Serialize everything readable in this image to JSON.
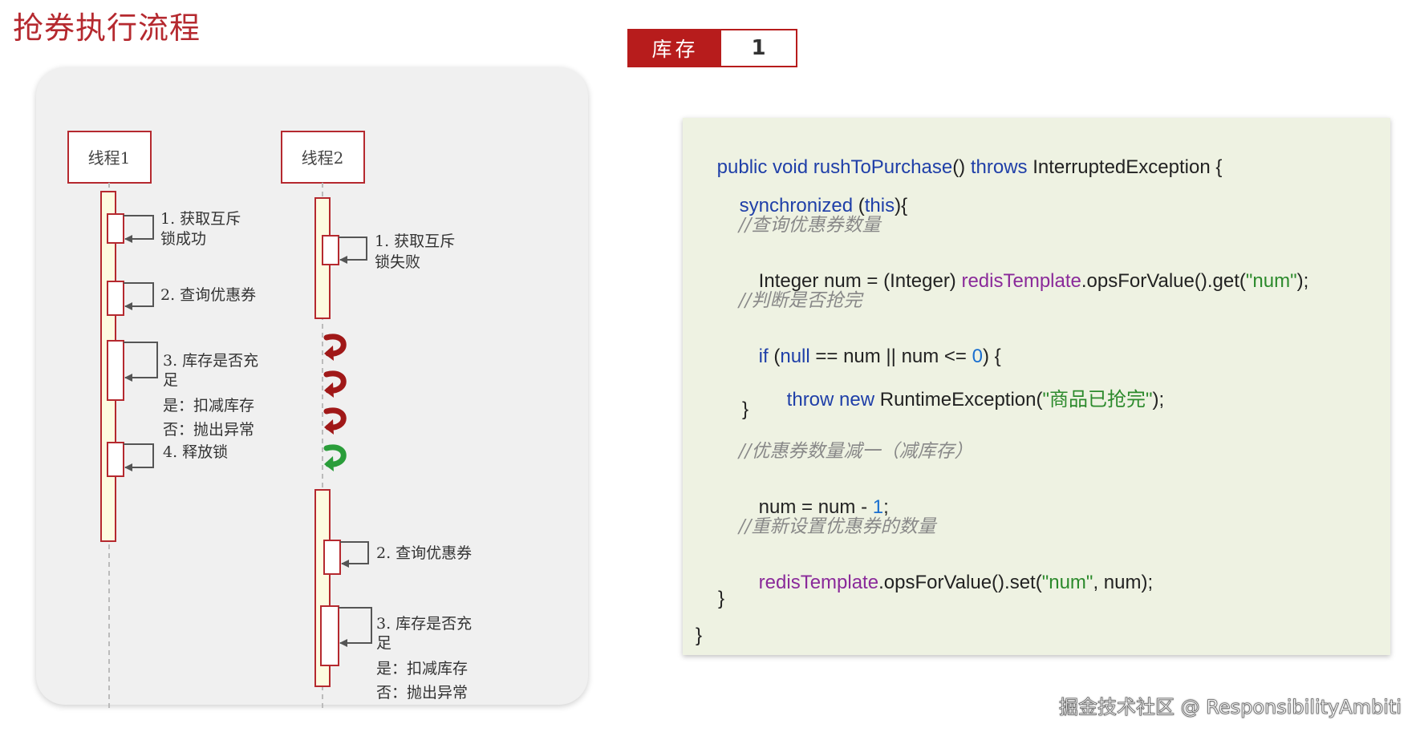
{
  "title": "抢券执行流程",
  "stock": {
    "label": "库存",
    "value": "1"
  },
  "colors": {
    "accent": "#b71c1c",
    "fail_arrow": "#a01818",
    "success_arrow": "#2a9d3a"
  },
  "threads": {
    "t1": {
      "label": "线程1",
      "steps": [
        "1. 获取互斥",
        "锁成功",
        "2. 查询优惠券",
        "3. 库存是否充",
        "足",
        "是：扣减库存",
        "否：抛出异常",
        "4. 释放锁"
      ]
    },
    "t2": {
      "label": "线程2",
      "steps": [
        "1. 获取互斥",
        "锁失败",
        "2. 查询优惠券",
        "3. 库存是否充",
        "足",
        "是：扣减库存",
        "否：抛出异常"
      ]
    },
    "retry_icons": [
      "fail-retry-arrow-icon",
      "fail-retry-arrow-icon",
      "fail-retry-arrow-icon",
      "success-arrow-icon"
    ]
  },
  "code": {
    "l1": {
      "a": "public void ",
      "b": "rushToPurchase",
      "c": "() ",
      "d": "throws",
      "e": " InterruptedException {"
    },
    "l2": {
      "a": "synchronized",
      "b": " (",
      "c": "this",
      "d": "){"
    },
    "l3": "//查询优惠券数量",
    "l4": {
      "a": "Integer num = (Integer) ",
      "b": "redisTemplate",
      "c": ".opsForValue().get(",
      "d": "\"num\"",
      "e": ");"
    },
    "l5": "//判断是否抢完",
    "l6": {
      "a": "if",
      "b": " (",
      "c": "null",
      "d": " == num || num <= ",
      "e": "0",
      "f": ") {"
    },
    "l7": {
      "a": "throw new",
      "b": " RuntimeException(",
      "c": "\"商品已抢完\"",
      "d": ");"
    },
    "l8": "}",
    "l9": "//优惠券数量减一（减库存）",
    "l10": {
      "a": "num = num - ",
      "b": "1",
      "c": ";"
    },
    "l11": "//重新设置优惠券的数量",
    "l12": {
      "a": "redisTemplate",
      "b": ".opsForValue().set(",
      "c": "\"num\"",
      "d": ", num);"
    },
    "l13": "}",
    "l14": "}"
  },
  "watermark": "掘金技术社区 @ ResponsibilityAmbiti"
}
